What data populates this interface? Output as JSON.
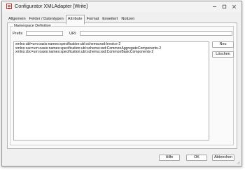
{
  "window": {
    "title": "Configurator XMLAdapter [Write]"
  },
  "tabs": [
    {
      "label": "Allgemein"
    },
    {
      "label": "Felder / Datentypen"
    },
    {
      "label": "Attribute"
    },
    {
      "label": "Format"
    },
    {
      "label": "Erweitert"
    },
    {
      "label": "Notizen"
    }
  ],
  "active_tab": "Attribute",
  "namespace": {
    "group_title": "Namespace Definition",
    "prefix_label": "Prefix",
    "prefix_value": "",
    "uri_label": "URI",
    "uri_value": "",
    "entries": [
      "xmlns:ubl=urn:oasis:names:specification:ubl:schema:xsd:Invoice-2",
      "xmlns:cac=urn:oasis:names:specification:ubl:schema:xsd:CommonAggregateComponents-2",
      "xmlns:cbc=urn:oasis:names:specification:ubl:schema:xsd:CommonBasicComponents-2"
    ],
    "new_label": "Neu",
    "delete_label": "Löschen"
  },
  "footer": {
    "help_label": "Hilfe",
    "ok_label": "OK",
    "cancel_label": "Abbrechen"
  },
  "icons": {
    "app": "xml-document-icon",
    "minimize": "minimize-icon",
    "maximize": "maximize-icon",
    "close": "close-icon"
  },
  "colors": {
    "accent": "#c0392b",
    "window_bg": "#f0f0f0",
    "panel_bg": "#fafafa"
  }
}
